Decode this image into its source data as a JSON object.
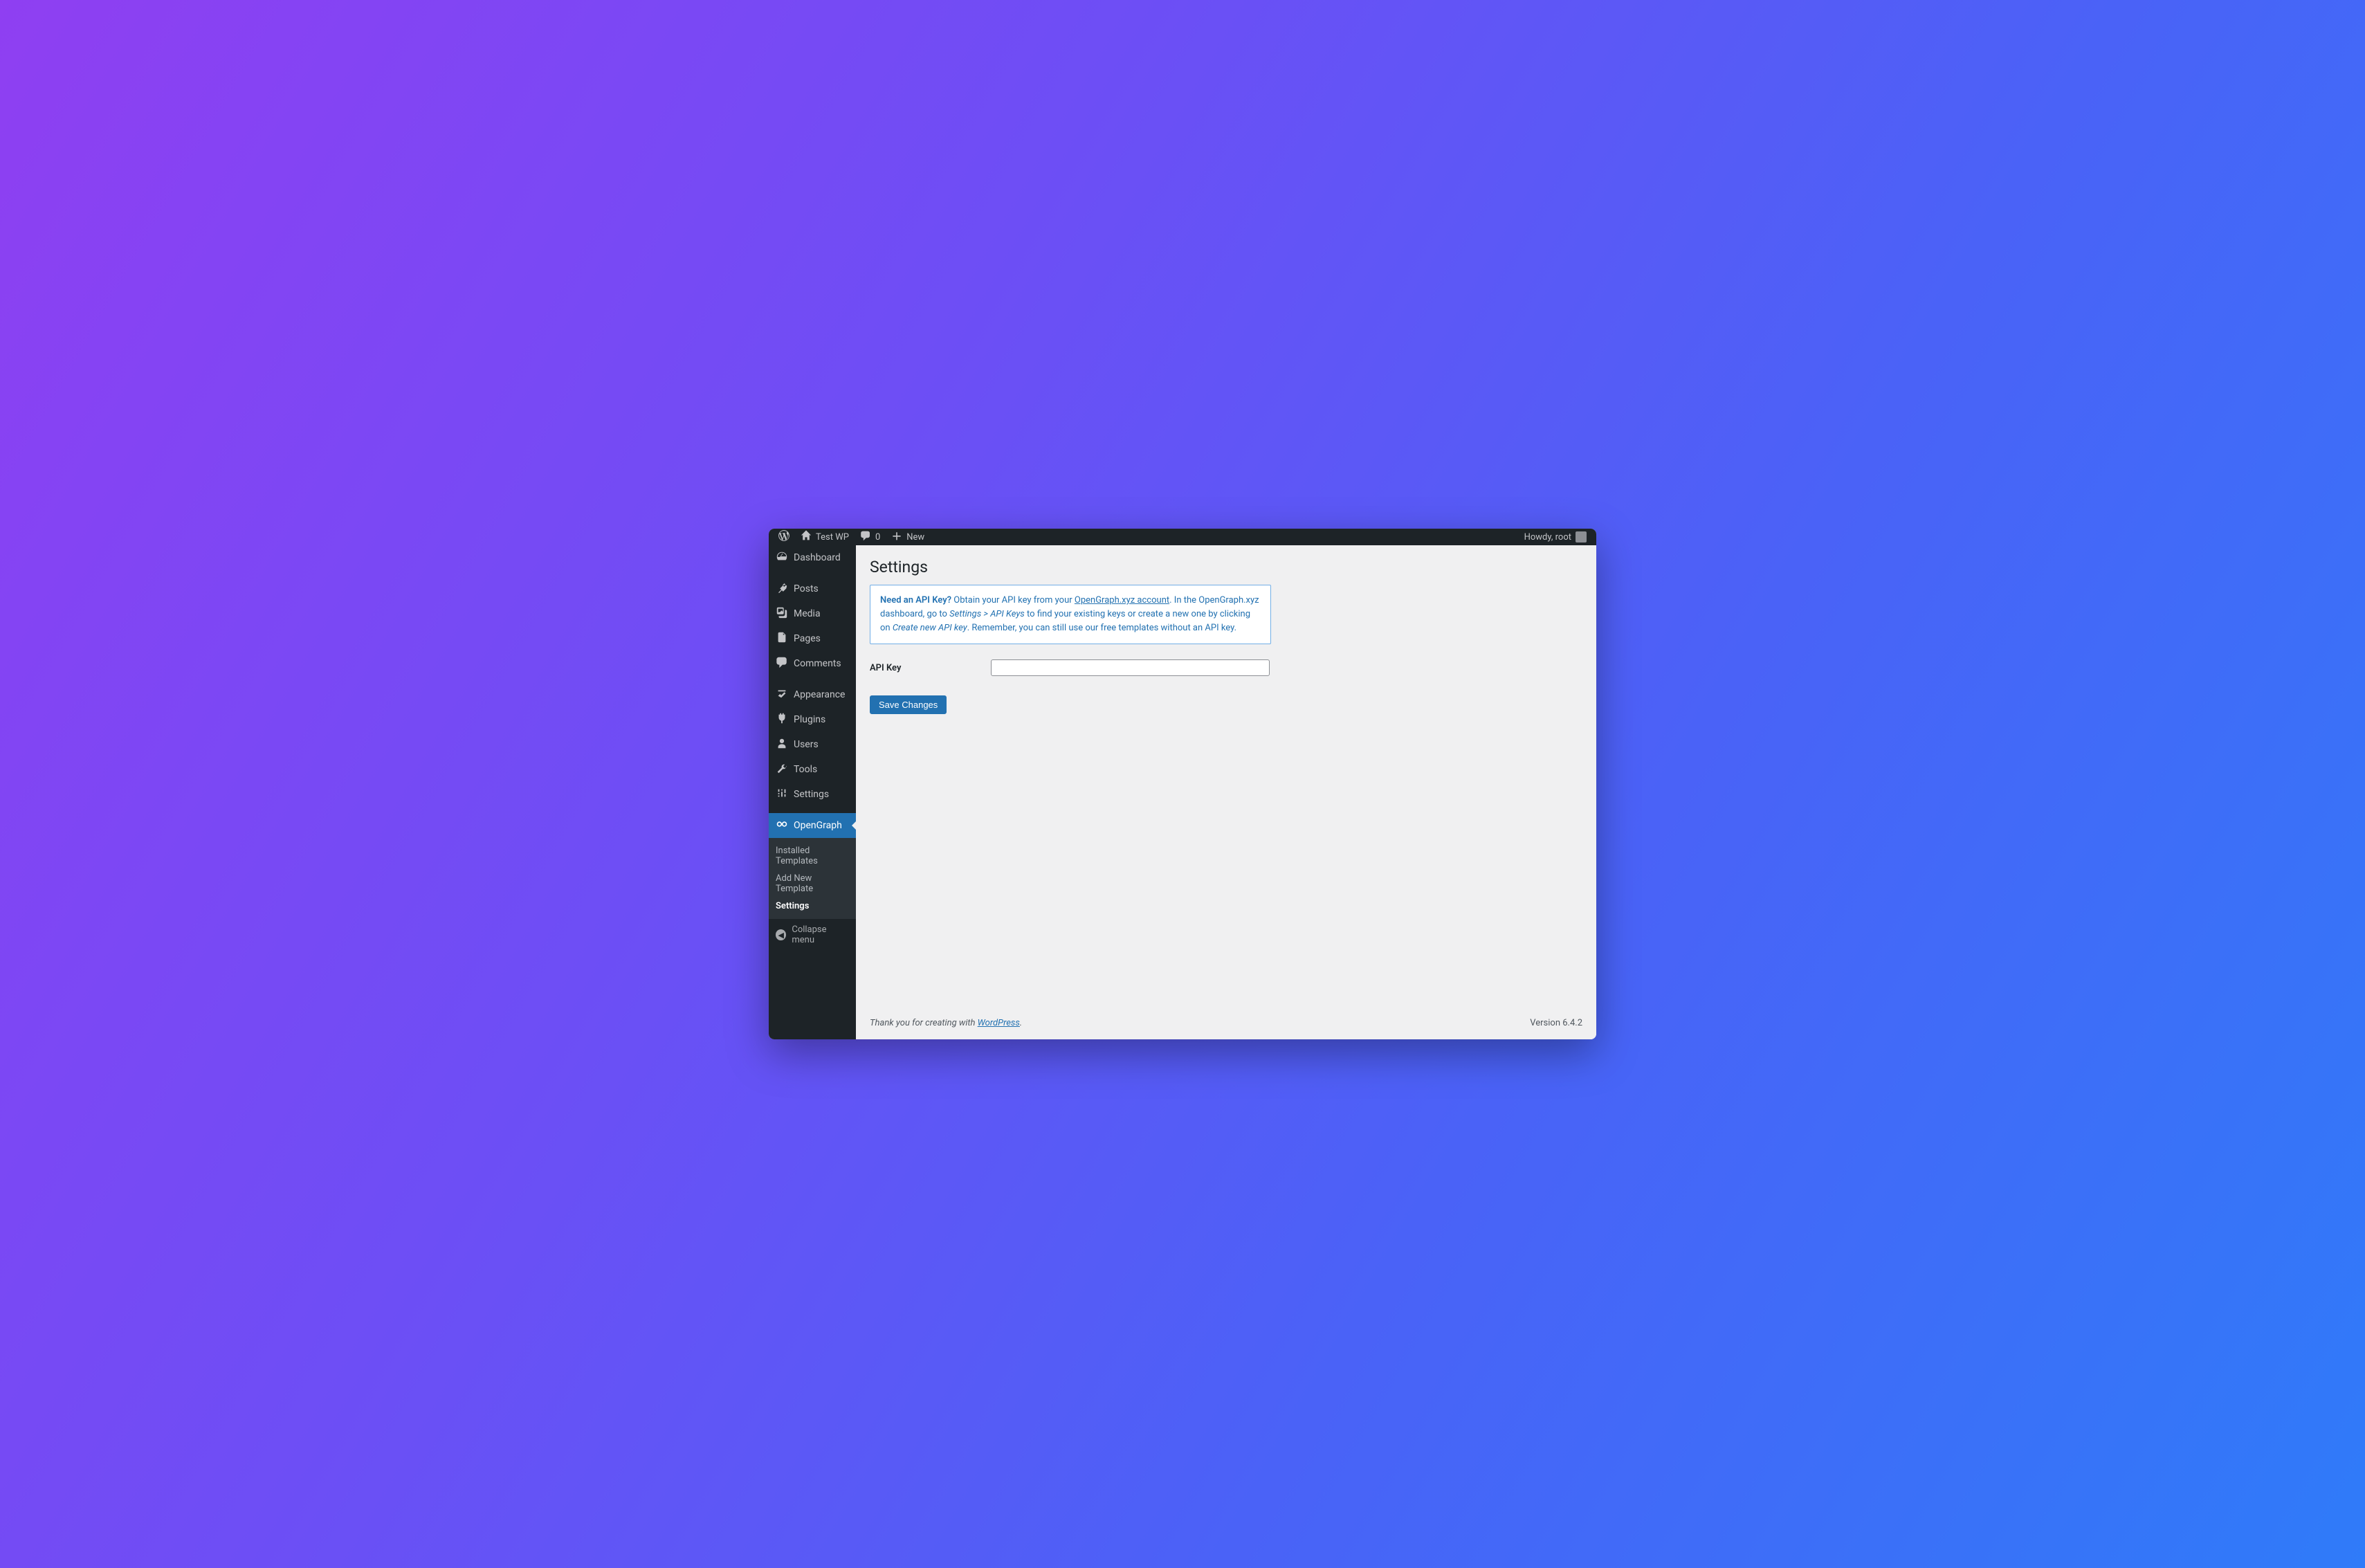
{
  "adminbar": {
    "site_name": "Test WP",
    "comments_count": "0",
    "new_label": "New",
    "howdy_prefix": "Howdy, ",
    "username": "root"
  },
  "sidebar": {
    "items": [
      {
        "id": "dashboard",
        "label": "Dashboard"
      },
      {
        "id": "posts",
        "label": "Posts"
      },
      {
        "id": "media",
        "label": "Media"
      },
      {
        "id": "pages",
        "label": "Pages"
      },
      {
        "id": "comments",
        "label": "Comments"
      },
      {
        "id": "appearance",
        "label": "Appearance"
      },
      {
        "id": "plugins",
        "label": "Plugins"
      },
      {
        "id": "users",
        "label": "Users"
      },
      {
        "id": "tools",
        "label": "Tools"
      },
      {
        "id": "settings",
        "label": "Settings"
      },
      {
        "id": "opengraph",
        "label": "OpenGraph"
      }
    ],
    "submenu": {
      "items": [
        {
          "id": "installed-templates",
          "label": "Installed Templates"
        },
        {
          "id": "add-new-template",
          "label": "Add New Template"
        },
        {
          "id": "og-settings",
          "label": "Settings"
        }
      ]
    },
    "collapse_label": "Collapse menu"
  },
  "page": {
    "title": "Settings",
    "notice": {
      "lead": "Need an API Key?",
      "t1": " Obtain your API key from your ",
      "link": "OpenGraph.xyz account",
      "t2": ". In the OpenGraph.xyz dashboard, go to ",
      "em1": "Settings > API Keys",
      "t3": " to find your existing keys or create a new one by clicking on ",
      "em2": "Create new API key",
      "t4": ". Remember, you can still use our free templates without an API key."
    },
    "form": {
      "api_key_label": "API Key",
      "api_key_value": "",
      "save_button": "Save Changes"
    }
  },
  "footer": {
    "thanks_prefix": "Thank you for creating with ",
    "thanks_link": "WordPress",
    "thanks_suffix": ".",
    "version": "Version 6.4.2"
  }
}
